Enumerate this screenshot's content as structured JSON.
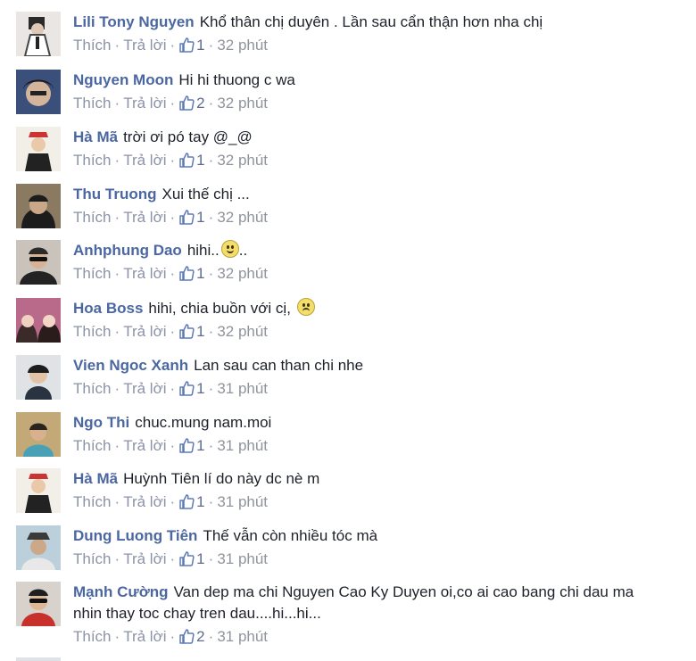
{
  "comments": [
    {
      "author": "Lili Tony Nguyen",
      "text": "Khổ thân chị duyên . Lần sau cẩn thận hơn nha chị",
      "like_label": "Thích",
      "reply_label": "Trả lời",
      "likes": "1",
      "time": "32 phút"
    },
    {
      "author": "Nguyen Moon",
      "text": "Hi hi thuong c wa",
      "like_label": "Thích",
      "reply_label": "Trả lời",
      "likes": "2",
      "time": "32 phút"
    },
    {
      "author": "Hà Mã",
      "text": "trời ơi pó tay @_@",
      "like_label": "Thích",
      "reply_label": "Trả lời",
      "likes": "1",
      "time": "32 phút"
    },
    {
      "author": "Thu Truong",
      "text": "Xui thế chị ...",
      "like_label": "Thích",
      "reply_label": "Trả lời",
      "likes": "1",
      "time": "32 phút"
    },
    {
      "author": "Anhphung Dao",
      "text": "hihi..",
      "text_after": "..",
      "emoji": "smile-emoji",
      "like_label": "Thích",
      "reply_label": "Trả lời",
      "likes": "1",
      "time": "32 phút"
    },
    {
      "author": "Hoa Boss",
      "text": "hihi, chia buồn với cị,",
      "emoji": "sad-emoji",
      "like_label": "Thích",
      "reply_label": "Trả lời",
      "likes": "1",
      "time": "32 phút"
    },
    {
      "author": "Vien Ngoc Xanh",
      "text": "Lan sau can than chi nhe",
      "like_label": "Thích",
      "reply_label": "Trả lời",
      "likes": "1",
      "time": "31 phút"
    },
    {
      "author": "Ngo Thi",
      "text": "chuc.mung nam.moi",
      "like_label": "Thích",
      "reply_label": "Trả lời",
      "likes": "1",
      "time": "31 phút"
    },
    {
      "author": "Hà Mã",
      "text": "Huỳnh Tiên lí do này dc nè m",
      "like_label": "Thích",
      "reply_label": "Trả lời",
      "likes": "1",
      "time": "31 phút"
    },
    {
      "author": "Dung Luong Tiên",
      "text": "Thế vẫn còn nhiều tóc mà",
      "like_label": "Thích",
      "reply_label": "Trả lời",
      "likes": "1",
      "time": "31 phút"
    },
    {
      "author": "Mạnh Cường",
      "text": "Van dep ma chi Nguyen Cao Ky Duyen oi,co ai cao bang chi dau ma nhin thay toc chay tren dau....hi...hi...",
      "like_label": "Thích",
      "reply_label": "Trả lời",
      "likes": "2",
      "time": "31 phút"
    }
  ]
}
